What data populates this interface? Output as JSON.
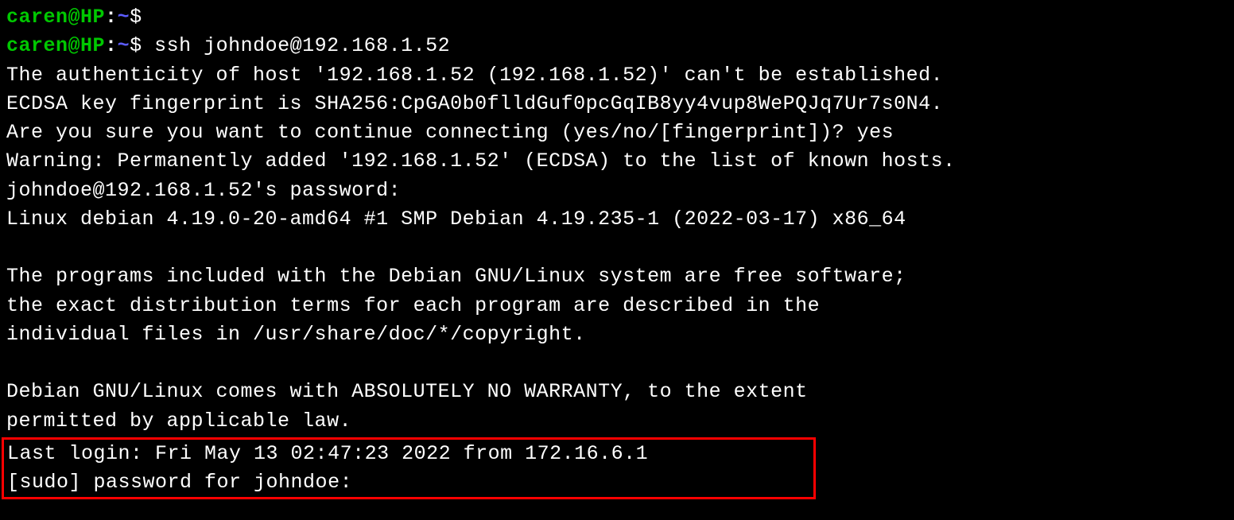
{
  "prompt1": {
    "user": "caren",
    "at": "@",
    "host": "HP",
    "colon": ":",
    "path": "~",
    "symbol": "$",
    "command": ""
  },
  "prompt2": {
    "user": "caren",
    "at": "@",
    "host": "HP",
    "colon": ":",
    "path": "~",
    "symbol": "$",
    "command": " ssh johndoe@192.168.1.52"
  },
  "output": {
    "l1": "The authenticity of host '192.168.1.52 (192.168.1.52)' can't be established.",
    "l2": "ECDSA key fingerprint is SHA256:CpGA0b0flldGuf0pcGqIB8yy4vup8WePQJq7Ur7s0N4.",
    "l3": "Are you sure you want to continue connecting (yes/no/[fingerprint])? yes",
    "l4": "Warning: Permanently added '192.168.1.52' (ECDSA) to the list of known hosts.",
    "l5": "johndoe@192.168.1.52's password:",
    "l6": "Linux debian 4.19.0-20-amd64 #1 SMP Debian 4.19.235-1 (2022-03-17) x86_64",
    "l7": "The programs included with the Debian GNU/Linux system are free software;",
    "l8": "the exact distribution terms for each program are described in the",
    "l9": "individual files in /usr/share/doc/*/copyright.",
    "l10": "Debian GNU/Linux comes with ABSOLUTELY NO WARRANTY, to the extent",
    "l11": "permitted by applicable law.",
    "l12": "Last login: Fri May 13 02:47:23 2022 from 172.16.6.1",
    "l13": "[sudo] password for johndoe:"
  }
}
